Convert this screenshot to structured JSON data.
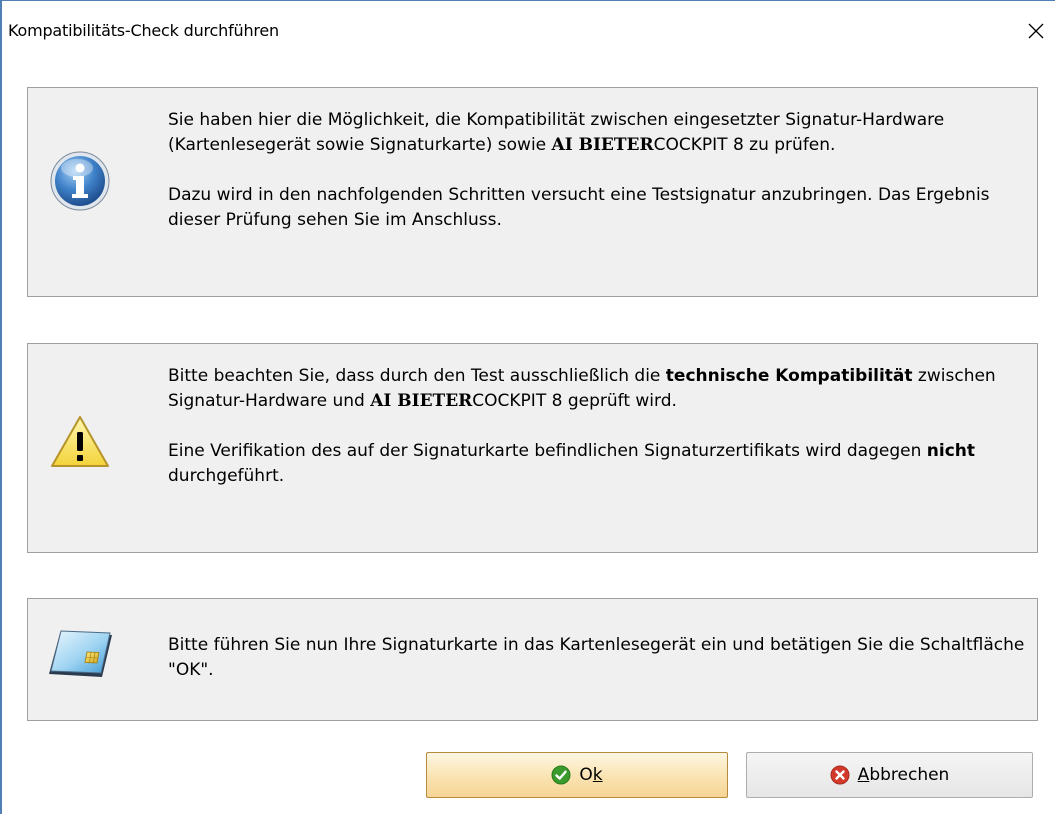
{
  "dialog": {
    "title": "Kompatibilitäts-Check durchführen",
    "close_icon": "close-icon"
  },
  "info_panel": {
    "icon": "info-icon",
    "para1": {
      "text_before": "Sie haben hier die Möglichkeit, die Kompatibilität zwischen eingesetzter Signatur-Hardware (Kartenlesegerät sowie Signaturkarte) sowie ",
      "brand_bold": "AI BIETER",
      "brand_rest": "COCKPIT 8 zu prüfen."
    },
    "para2": "Dazu wird in den nachfolgenden Schritten versucht eine Testsignatur anzubringen. Das Ergebnis dieser Prüfung sehen Sie im Anschluss."
  },
  "warn_panel": {
    "icon": "warning-icon",
    "para1": {
      "text_before": "Bitte beachten Sie, dass durch den Test ausschließlich die ",
      "bold1": "technische Kompatibilität",
      "text_mid": " zwischen Signatur-Hardware und ",
      "brand_bold": "AI BIETER",
      "brand_rest": "COCKPIT 8 geprüft wird."
    },
    "para2": {
      "text_before": "Eine Verifikation des auf der Signaturkarte befindlichen Signaturzertifikats wird dagegen ",
      "bold": "nicht",
      "text_after": " durchgeführt."
    }
  },
  "card_panel": {
    "icon": "smartcard-icon",
    "text": "Bitte führen Sie nun Ihre Signaturkarte in das Kartenlesegerät ein und betätigen Sie die Schaltfläche \"OK\"."
  },
  "buttons": {
    "ok": {
      "label_prefix": "O",
      "label_underlined": "k",
      "icon": "check-icon",
      "color": "#3a9a2b"
    },
    "cancel": {
      "label_underlined": "A",
      "label_rest": "bbrechen",
      "icon": "cancel-icon",
      "color": "#d33a2c"
    }
  }
}
